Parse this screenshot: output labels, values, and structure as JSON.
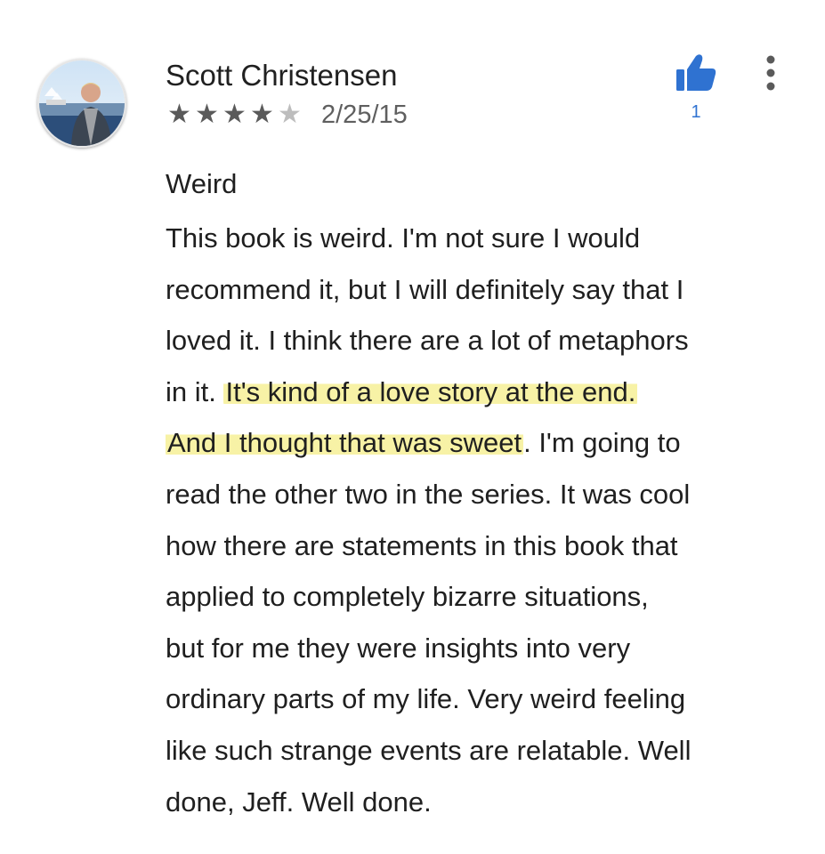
{
  "review": {
    "reviewer_name": "Scott Christensen",
    "rating": 4,
    "rating_max": 5,
    "date": "2/25/15",
    "like_count": "1",
    "title": "Weird",
    "body_lines": [
      {
        "before": "This book is weird. I'm not sure I would",
        "highlight": "",
        "after": ""
      },
      {
        "before": "recommend it, but I will definitely say that I",
        "highlight": "",
        "after": ""
      },
      {
        "before": "loved it. I think there are a lot of metaphors",
        "highlight": "",
        "after": ""
      },
      {
        "before": "in it. ",
        "highlight": "It's kind of a love story at the end.",
        "after": ""
      },
      {
        "before": "",
        "highlight": "And I thought that was sweet",
        "after": ". I'm going to"
      },
      {
        "before": "read the other two in the series. It was cool",
        "highlight": "",
        "after": ""
      },
      {
        "before": "how there are statements in this book that",
        "highlight": "",
        "after": ""
      },
      {
        "before": "applied to completely bizarre situations,",
        "highlight": "",
        "after": ""
      },
      {
        "before": "but for me they were insights into very",
        "highlight": "",
        "after": ""
      },
      {
        "before": "ordinary parts of my life. Very weird feeling",
        "highlight": "",
        "after": ""
      },
      {
        "before": "like such strange events are relatable. Well",
        "highlight": "",
        "after": ""
      },
      {
        "before": "done, Jeff. Well done.",
        "highlight": "",
        "after": ""
      }
    ]
  },
  "icons": {
    "avatar": "user-photo-avatar",
    "star_filled": "star-filled-icon",
    "star_empty": "star-empty-icon",
    "thumbs_up": "thumbs-up-icon",
    "more": "more-vertical-icon"
  },
  "colors": {
    "accent_blue": "#2f72d1",
    "star_filled": "#5a5a5a",
    "star_empty": "#bdbdbd",
    "highlight": "#f6f096"
  }
}
